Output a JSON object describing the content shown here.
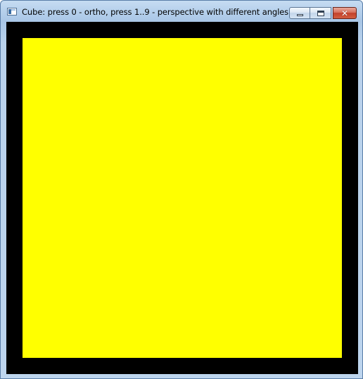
{
  "window": {
    "title": "Cube: press 0 - ortho, press 1..9 - perspective with different angles",
    "icon": "app-window-icon",
    "controls": {
      "minimize_icon": "minimize-icon",
      "maximize_icon": "maximize-icon",
      "close_glyph": "✕"
    }
  },
  "canvas": {
    "background_color": "#000000",
    "face_color": "#ffff00"
  }
}
